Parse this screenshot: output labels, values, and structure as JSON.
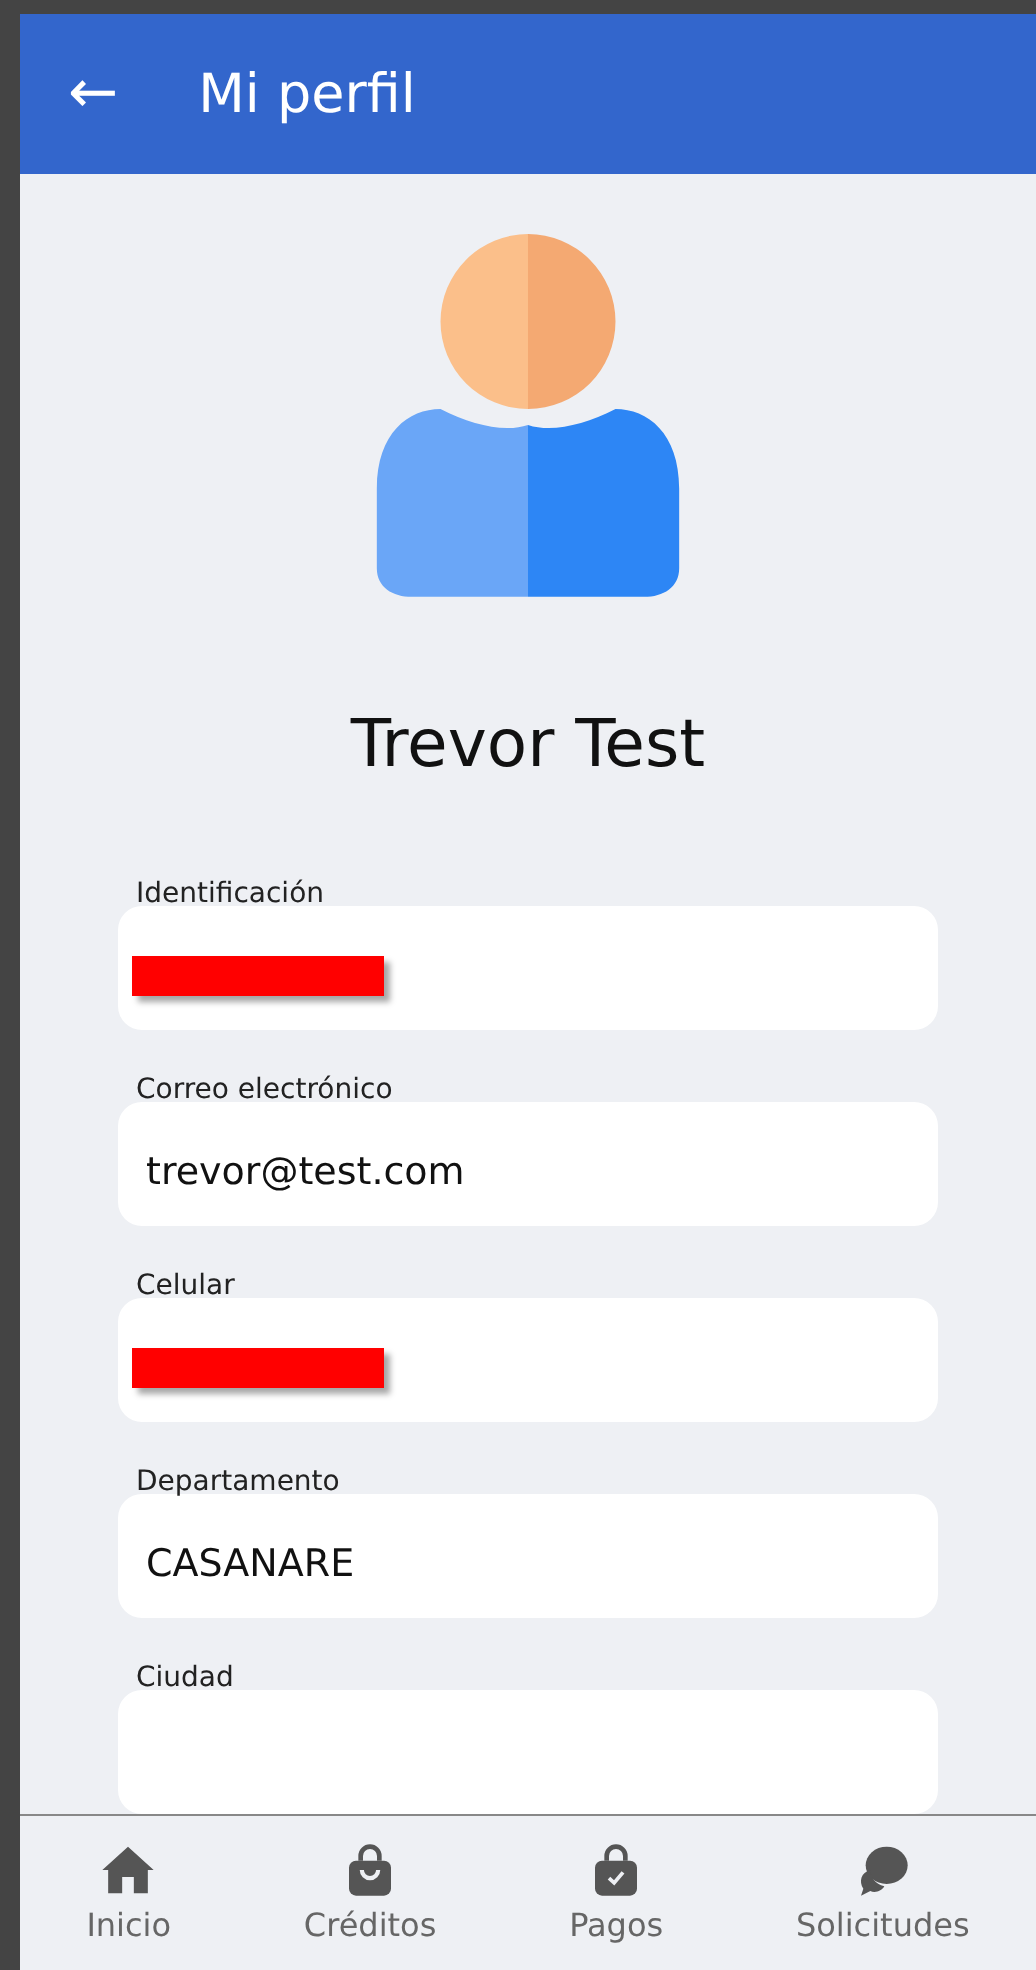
{
  "app_bar": {
    "back_icon": "←",
    "title": "Mi perfil"
  },
  "profile": {
    "name": "Trevor Test"
  },
  "fields": [
    {
      "label": "Identificación",
      "kind": "redacted"
    },
    {
      "label": "Correo electrónico",
      "kind": "text",
      "value": "trevor@test.com"
    },
    {
      "label": "Celular",
      "kind": "redacted"
    },
    {
      "label": "Departamento",
      "kind": "text",
      "value": "CASANARE"
    },
    {
      "label": "Ciudad",
      "kind": "text"
    }
  ],
  "bottom_nav": [
    {
      "label": "Inicio",
      "kind": "home"
    },
    {
      "label": "Créditos",
      "kind": "bag"
    },
    {
      "label": "Pagos",
      "kind": "bag-check"
    },
    {
      "label": "Solicitudes",
      "kind": "chat"
    }
  ]
}
